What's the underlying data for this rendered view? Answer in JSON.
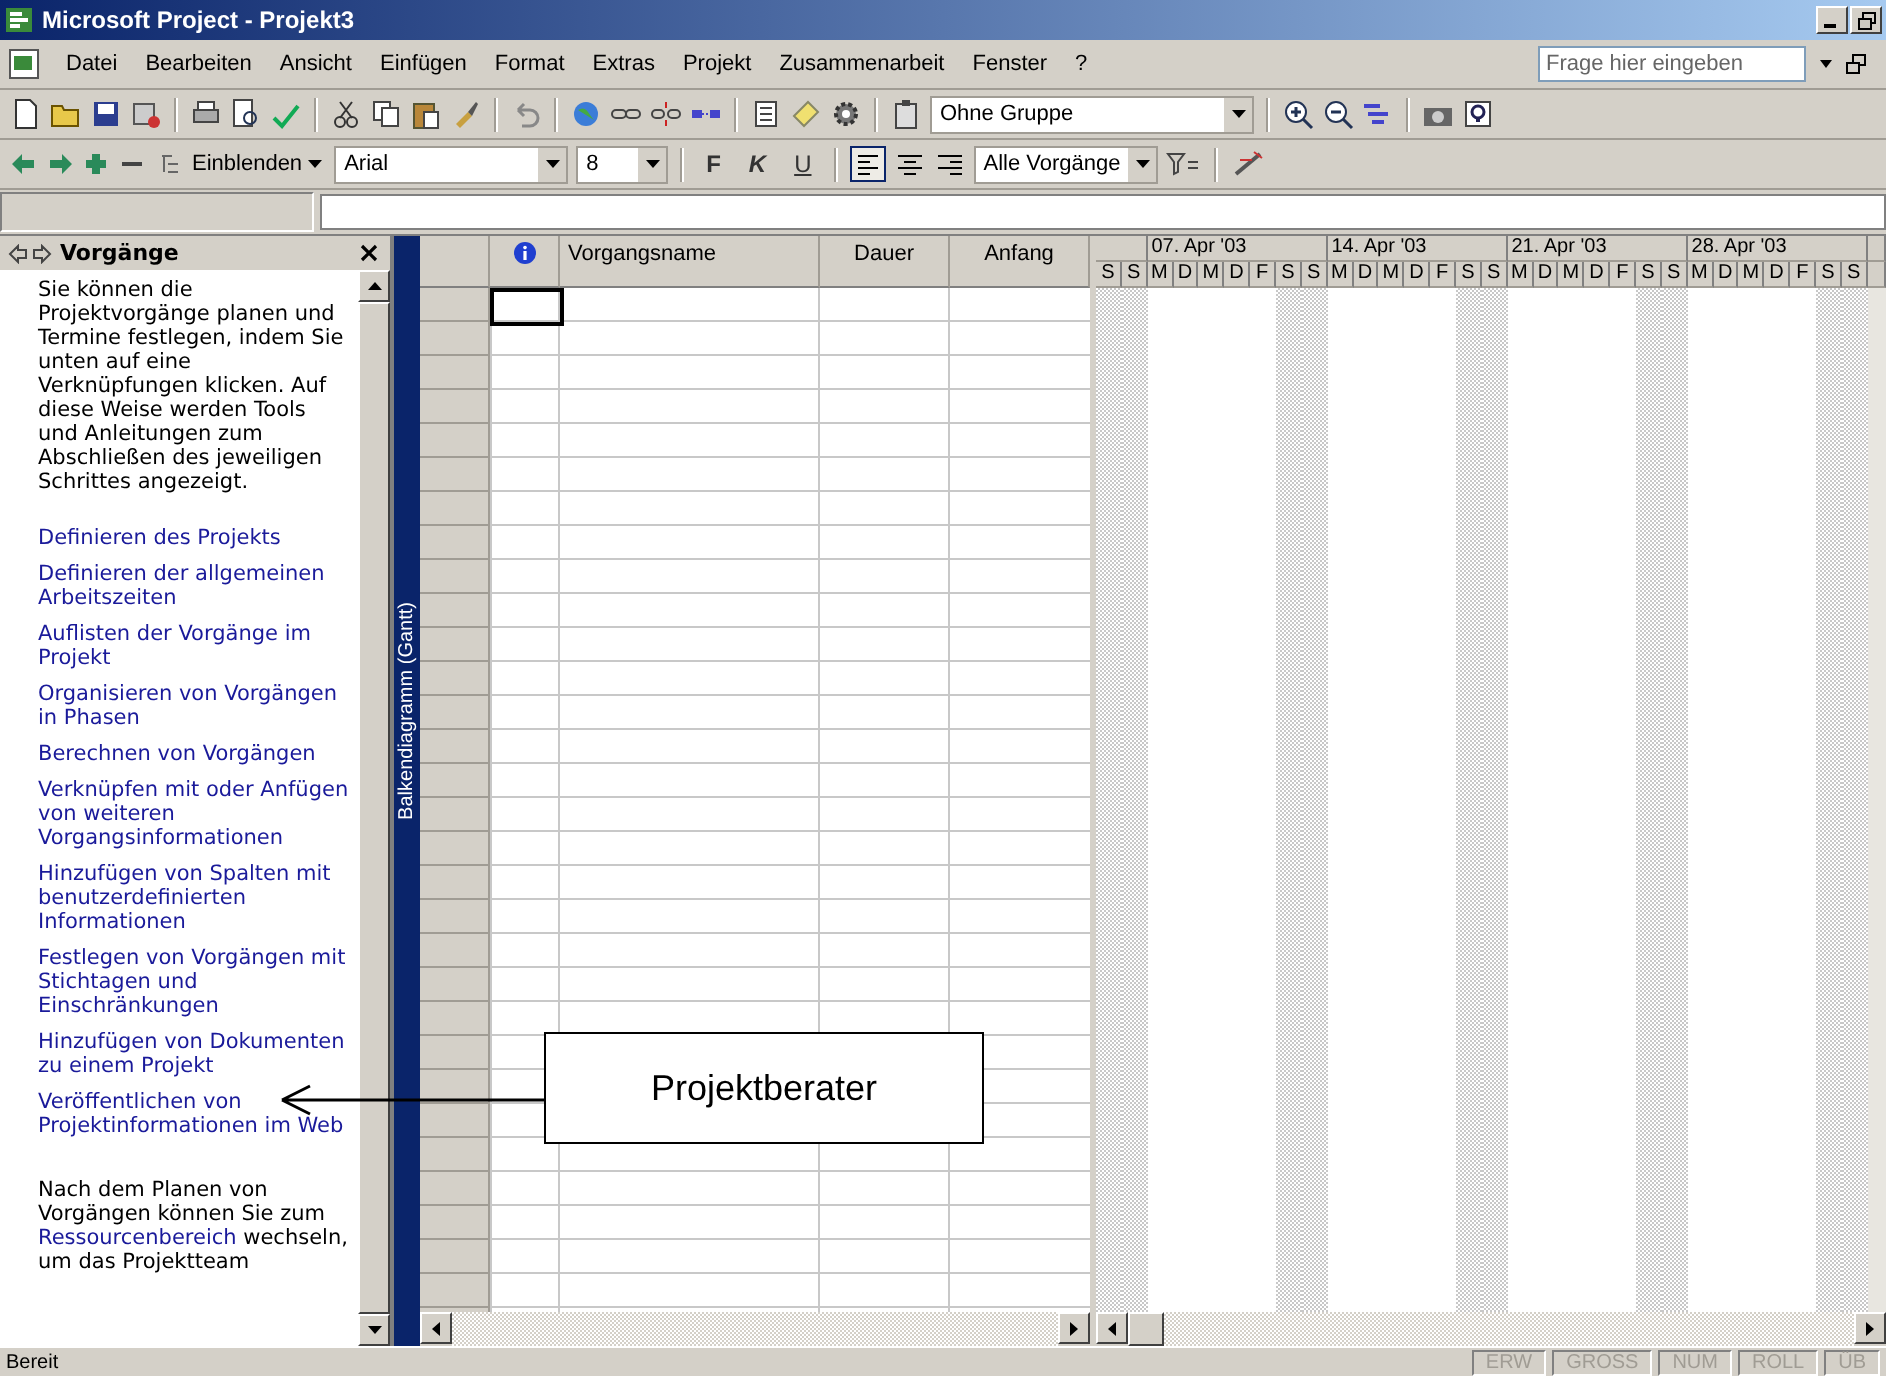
{
  "window": {
    "title": "Microsoft Project - Projekt3"
  },
  "menu": [
    "Datei",
    "Bearbeiten",
    "Ansicht",
    "Einfügen",
    "Format",
    "Extras",
    "Projekt",
    "Zusammenarbeit",
    "Fenster",
    "?"
  ],
  "help_box": {
    "placeholder": "Frage hier eingeben"
  },
  "standard_toolbar": {
    "group_dropdown": "Ohne Gruppe"
  },
  "format_toolbar": {
    "show_button": "Einblenden",
    "font": "Arial",
    "size": "8",
    "bold": "F",
    "italic": "K",
    "underline": "U",
    "filter": "Alle Vorgänge"
  },
  "task_pane": {
    "title": "Vorgänge",
    "intro": "Sie können die Projektvorgänge planen und Termine festlegen, indem Sie unten auf eine Verknüpfungen klicken. Auf diese Weise werden Tools und Anleitungen zum Abschließen des jeweiligen Schrittes angezeigt.",
    "links": [
      "Definieren des Projekts",
      "Definieren der allgemeinen Arbeitszeiten",
      "Auflisten der Vorgänge im Projekt",
      "Organisieren von Vorgängen in Phasen",
      "Berechnen von Vorgängen",
      "Verknüpfen mit oder Anfügen von weiteren Vorgangsinformationen",
      "Hinzufügen von Spalten mit benutzerdefinierten Informationen",
      "Festlegen von Vorgängen mit Stichtagen und Einschränkungen",
      "Hinzufügen von Dokumenten zu einem Projekt",
      "Veröffentlichen von Projektinformationen im Web"
    ],
    "footer_before": "Nach dem Planen von Vorgängen können Sie zum",
    "footer_link": "Ressourcenbereich",
    "footer_after": "wechseln, um das Projektteam"
  },
  "view_bar": {
    "label": "Balkendiagramm (Gantt)"
  },
  "table": {
    "columns": [
      "Vorgangsname",
      "Dauer",
      "Anfang"
    ]
  },
  "gantt": {
    "weeks": [
      "07. Apr '03",
      "14. Apr '03",
      "21. Apr '03",
      "28. Apr '03"
    ],
    "days": [
      {
        "label": "S",
        "weekend": true
      },
      {
        "label": "S",
        "weekend": true
      },
      {
        "label": "M",
        "weekend": false
      },
      {
        "label": "D",
        "weekend": false
      },
      {
        "label": "M",
        "weekend": false
      },
      {
        "label": "D",
        "weekend": false
      },
      {
        "label": "F",
        "weekend": false
      },
      {
        "label": "S",
        "weekend": true
      },
      {
        "label": "S",
        "weekend": true
      },
      {
        "label": "M",
        "weekend": false
      },
      {
        "label": "D",
        "weekend": false
      },
      {
        "label": "M",
        "weekend": false
      },
      {
        "label": "D",
        "weekend": false
      },
      {
        "label": "F",
        "weekend": false
      },
      {
        "label": "S",
        "weekend": true
      },
      {
        "label": "S",
        "weekend": true
      },
      {
        "label": "M",
        "weekend": false
      },
      {
        "label": "D",
        "weekend": false
      },
      {
        "label": "M",
        "weekend": false
      },
      {
        "label": "D",
        "weekend": false
      },
      {
        "label": "F",
        "weekend": false
      },
      {
        "label": "S",
        "weekend": true
      },
      {
        "label": "S",
        "weekend": true
      },
      {
        "label": "M",
        "weekend": false
      },
      {
        "label": "D",
        "weekend": false
      },
      {
        "label": "M",
        "weekend": false
      },
      {
        "label": "D",
        "weekend": false
      },
      {
        "label": "F",
        "weekend": false
      },
      {
        "label": "S",
        "weekend": true
      },
      {
        "label": "S",
        "weekend": true
      }
    ]
  },
  "callout": {
    "text": "Projektberater"
  },
  "status_bar": {
    "status": "Bereit",
    "indicators": [
      "ERW",
      "GROSS",
      "NUM",
      "ROLL",
      "ÜB"
    ]
  }
}
